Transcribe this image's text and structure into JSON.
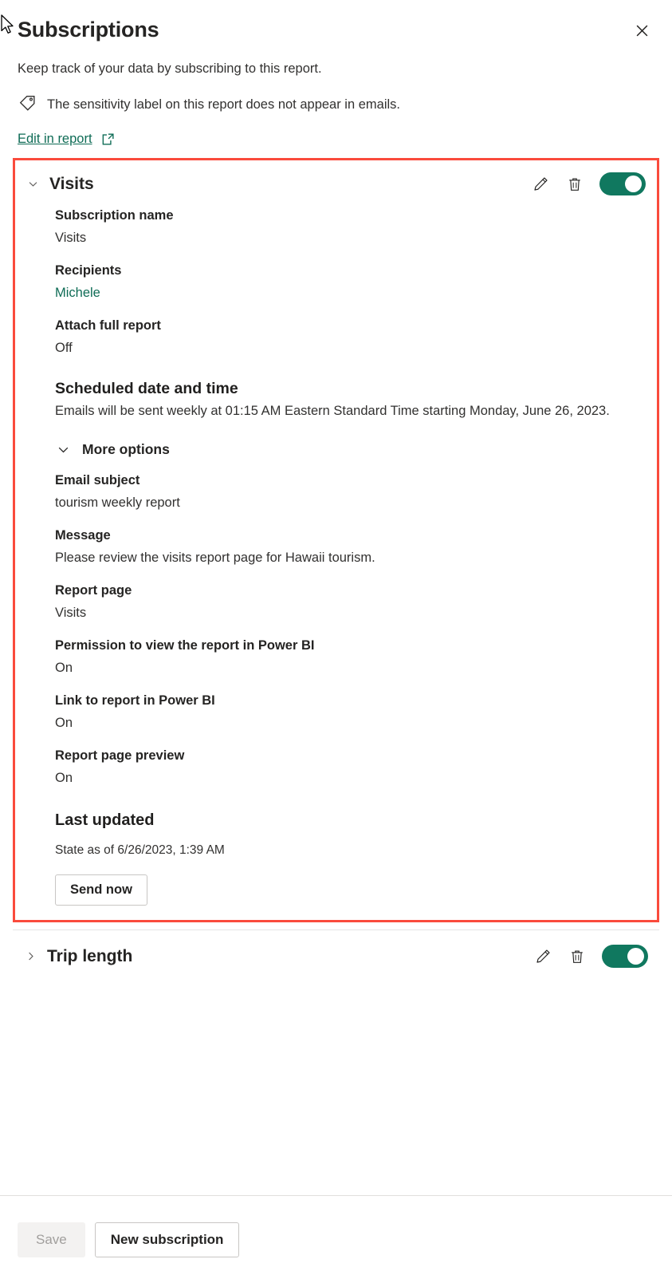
{
  "header": {
    "title": "Subscriptions",
    "close_label": "✕",
    "subtitle": "Keep track of your data by subscribing to this report.",
    "sensitivity_notice": "The sensitivity label on this report does not appear in emails.",
    "edit_link": "Edit in report"
  },
  "colors": {
    "accent_teal": "#0f6c56",
    "toggle_on": "#10785f",
    "highlight_red": "#fa4b3c",
    "text_primary": "#252423",
    "text_secondary": "#323130"
  },
  "subscriptions": [
    {
      "name": "Visits",
      "expanded": true,
      "toggle_state": "on",
      "fields": [
        {
          "label": "Subscription name",
          "value": "Visits"
        },
        {
          "label": "Recipients",
          "value": "Michele",
          "is_link": true
        },
        {
          "label": "Attach full report",
          "value": "Off"
        }
      ],
      "schedule": {
        "heading": "Scheduled date and time",
        "text": "Emails will be sent weekly at 01:15 AM Eastern Standard Time starting Monday, June 26, 2023."
      },
      "more_options_label": "More options",
      "more_fields": [
        {
          "label": "Email subject",
          "value": "tourism weekly report"
        },
        {
          "label": "Message",
          "value": "Please review the visits report page for Hawaii tourism."
        },
        {
          "label": "Report page",
          "value": "Visits"
        },
        {
          "label": "Permission to view the report in Power BI",
          "value": "On"
        },
        {
          "label": "Link to report in Power BI",
          "value": "On"
        },
        {
          "label": "Report page preview",
          "value": "On"
        }
      ],
      "last_updated": {
        "heading": "Last updated",
        "value": "State as of 6/26/2023, 1:39 AM"
      },
      "send_now_label": "Send now"
    },
    {
      "name": "Trip length",
      "expanded": false,
      "toggle_state": "on"
    }
  ],
  "footer": {
    "save_label": "Save",
    "new_subscription_label": "New subscription"
  },
  "icons": {
    "chevron_down": "chevron-down-icon",
    "chevron_right": "chevron-right-icon",
    "edit": "pencil-icon",
    "delete": "trash-icon",
    "sensitivity": "tag-icon",
    "external": "open-in-new-icon"
  }
}
